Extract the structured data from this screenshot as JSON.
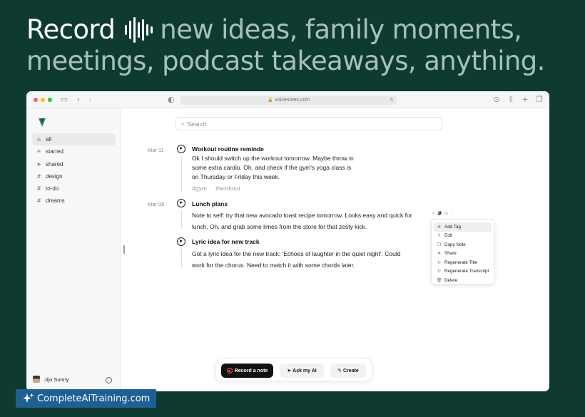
{
  "headline": {
    "line1_white": "Record",
    "line1_rest": "new ideas, family moments,",
    "line2": "meetings, podcast takeaways, anything.",
    "icon": "waveform-icon"
  },
  "browser": {
    "url": "voicenotes.com",
    "traffic_lights": [
      "#ff5f57",
      "#febc2e",
      "#28c840"
    ]
  },
  "sidebar": {
    "logo": "voicenotes-logo",
    "items": [
      {
        "label": "all",
        "icon": "inbox-icon",
        "glyph": "⌂",
        "active": true
      },
      {
        "label": "starred",
        "icon": "star-icon",
        "glyph": "✳",
        "active": false
      },
      {
        "label": "shared",
        "icon": "send-icon",
        "glyph": "➤",
        "active": false
      },
      {
        "label": "design",
        "icon": "hash-icon",
        "glyph": "#",
        "active": false
      },
      {
        "label": "to-do",
        "icon": "hash-icon",
        "glyph": "#",
        "active": false
      },
      {
        "label": "dreams",
        "icon": "hash-icon",
        "glyph": "#",
        "active": false
      }
    ],
    "user_name": "Jijo Sunny"
  },
  "search": {
    "placeholder": "Search"
  },
  "notes": [
    {
      "date": "Mar 11",
      "title": "Workout routine reminde",
      "body_lines": [
        "Ok I should switch up the workout tomorrow. Maybe throw in",
        "some extra cardio. Oh, and check if the gym's yoga class is",
        "on Thursday or Friday this week."
      ],
      "tags": [
        "#gym",
        "#workout"
      ]
    },
    {
      "date": "Mar 08",
      "title": "Lunch plans",
      "body_lines": [
        "Note to self: try that new avocado toast recipe tomorrow. Looks easy and quick for",
        "lunch. Oh, and grab some limes from the store for that zesty kick."
      ],
      "tags": []
    },
    {
      "date": "",
      "title": "Lyric idea for new track",
      "body_lines": [
        "Got a lyric idea for the new track: 'Echoes of laughter in the quiet night'. Could",
        "work for the chorus. Need to match it with some chords later."
      ],
      "tags": []
    }
  ],
  "context_menu": [
    {
      "label": "Add Tag",
      "icon": "hash-icon",
      "glyph": "#",
      "highlighted": true
    },
    {
      "label": "Edit",
      "icon": "pencil-icon",
      "glyph": "✎",
      "highlighted": false
    },
    {
      "label": "Copy Note",
      "icon": "copy-icon",
      "glyph": "❐",
      "highlighted": false
    },
    {
      "label": "Share",
      "icon": "share-icon",
      "glyph": "➤",
      "highlighted": false
    },
    {
      "label": "Regenerate Title",
      "icon": "refresh-icon",
      "glyph": "↻",
      "highlighted": false
    },
    {
      "label": "Regenerate Transcript",
      "icon": "refresh-icon",
      "glyph": "↻",
      "highlighted": false
    },
    {
      "label": "Delete",
      "icon": "trash-icon",
      "glyph": "🗑",
      "highlighted": false
    }
  ],
  "actions": {
    "record": "Record a note",
    "ask_ai": "Ask my AI",
    "create": "Create"
  },
  "brand": {
    "text": "CompleteAiTraining.com"
  },
  "colors": {
    "background": "#0f3a30",
    "headline_muted": "#a6c2b7",
    "brand_badge": "#1e5f94",
    "record_red": "#ff4d4d"
  }
}
